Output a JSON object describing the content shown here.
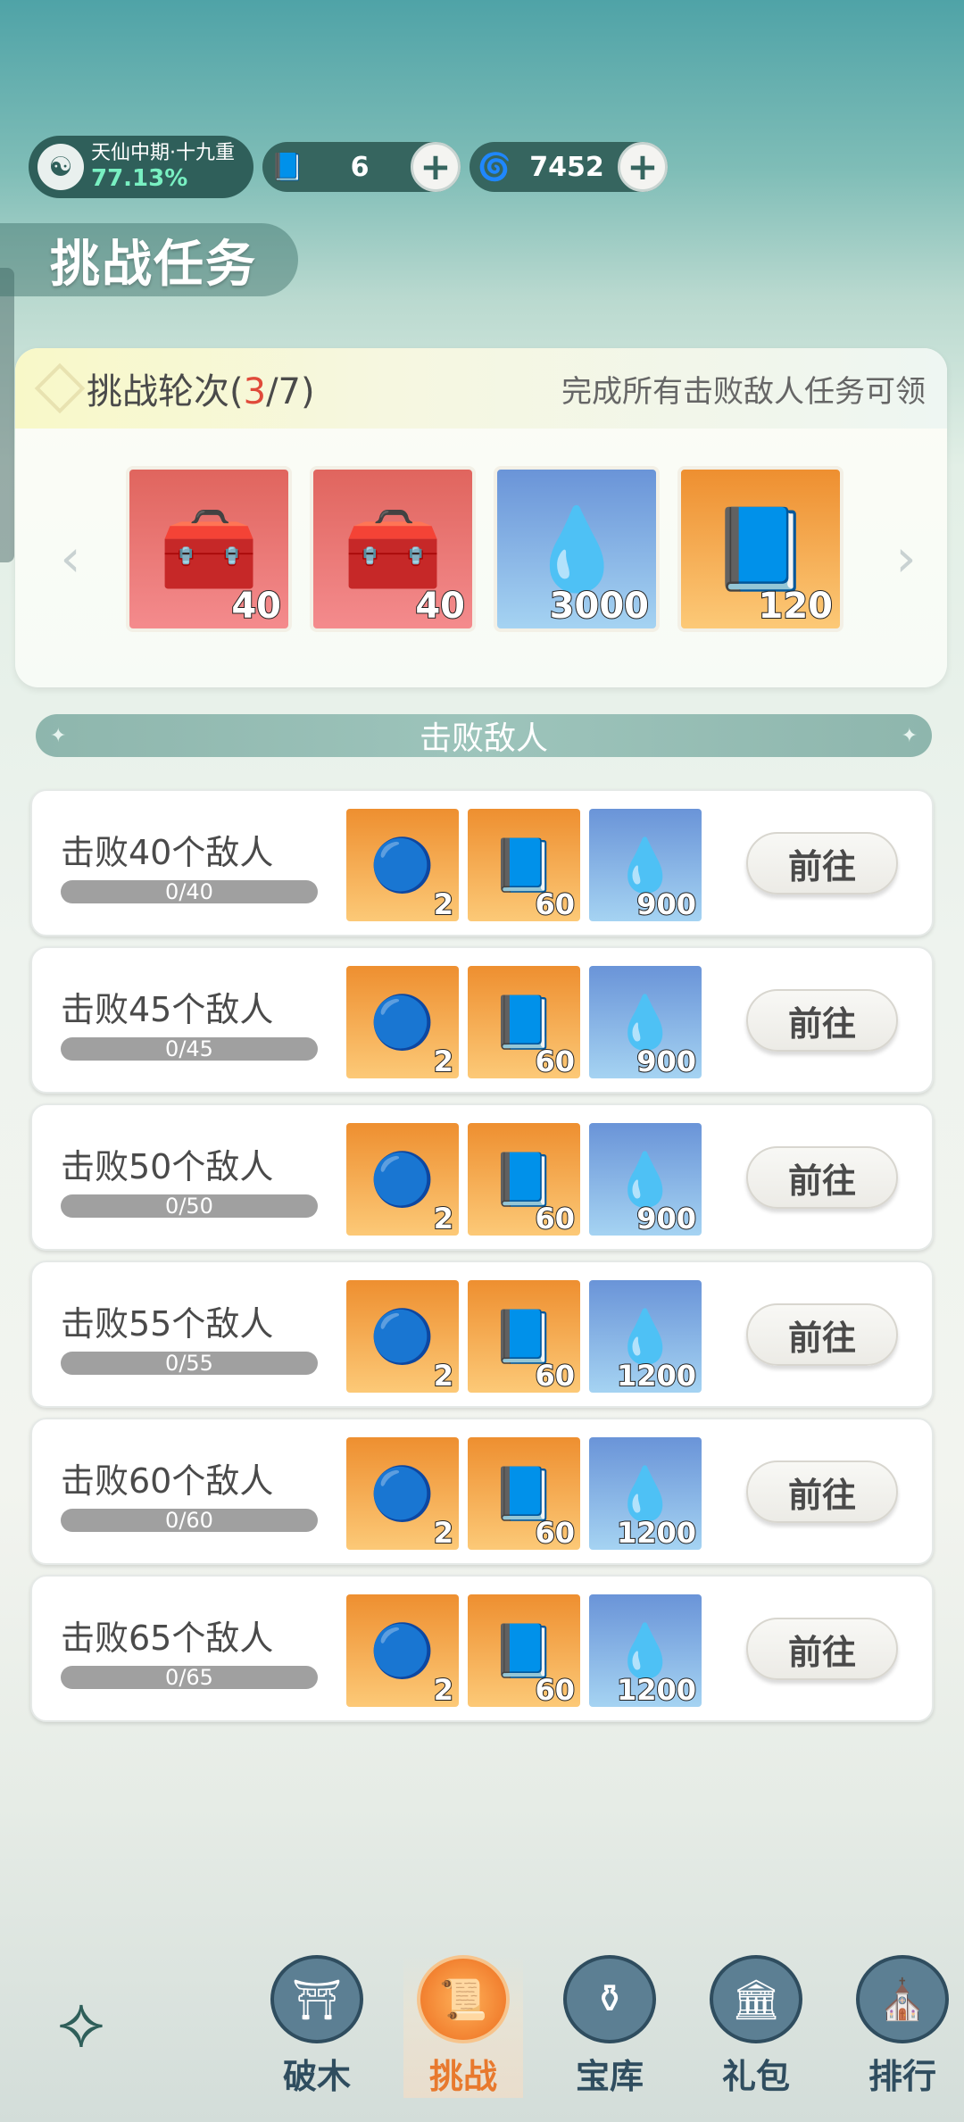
{
  "topbar": {
    "realm": {
      "label": "天仙中期·十九重",
      "percent": "77.13%",
      "icon": "cultivator-avatar-icon"
    },
    "resources": [
      {
        "icon": "scroll-book-icon",
        "value": "6"
      },
      {
        "icon": "spirit-flame-icon",
        "value": "7452"
      }
    ]
  },
  "page_title": "挑战任务",
  "rounds": {
    "label": "挑战轮次(",
    "current": "3",
    "total": "/7)",
    "hint": "完成所有击败敌人任务可领",
    "rewards": [
      {
        "icon": "treasure-chest-icon",
        "count": "40",
        "bg": "red"
      },
      {
        "icon": "treasure-chest-icon",
        "count": "40",
        "bg": "red"
      },
      {
        "icon": "spirit-flame-icon",
        "count": "3000",
        "bg": "blue"
      },
      {
        "icon": "scroll-book-icon",
        "count": "120",
        "bg": "orange"
      }
    ]
  },
  "section_title": "击败敌人",
  "tasks": [
    {
      "name": "击败40个敌人",
      "progress": "0/40",
      "rewards": [
        "2",
        "60",
        "900"
      ],
      "button": "前往"
    },
    {
      "name": "击败45个敌人",
      "progress": "0/45",
      "rewards": [
        "2",
        "60",
        "900"
      ],
      "button": "前往"
    },
    {
      "name": "击败50个敌人",
      "progress": "0/50",
      "rewards": [
        "2",
        "60",
        "900"
      ],
      "button": "前往"
    },
    {
      "name": "击败55个敌人",
      "progress": "0/55",
      "rewards": [
        "2",
        "60",
        "1200"
      ],
      "button": "前往"
    },
    {
      "name": "击败60个敌人",
      "progress": "0/60",
      "rewards": [
        "2",
        "60",
        "1200"
      ],
      "button": "前往"
    },
    {
      "name": "击败65个敌人",
      "progress": "0/65",
      "rewards": [
        "2",
        "60",
        "1200"
      ],
      "button": "前往"
    }
  ],
  "nav": [
    {
      "label": "破木",
      "icon": "figure-icon",
      "active": false
    },
    {
      "label": "挑战",
      "icon": "scroll-icon",
      "active": true
    },
    {
      "label": "宝库",
      "icon": "treasure-pot-icon",
      "active": false
    },
    {
      "label": "礼包",
      "icon": "temple-icon",
      "active": false
    },
    {
      "label": "排行",
      "icon": "tower-icon",
      "active": false
    }
  ],
  "colors": {
    "accent": "#e8792e",
    "teal": "#2f5f5a",
    "highlight_red": "#e04a3a"
  }
}
